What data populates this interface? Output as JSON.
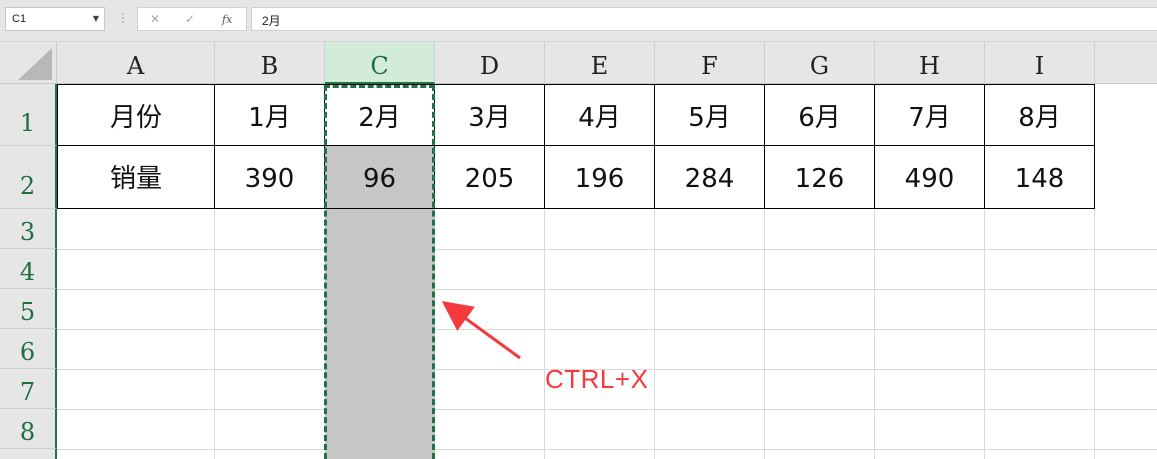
{
  "formula_bar": {
    "name_box": "C1",
    "cancel_glyph": "✕",
    "enter_glyph": "✓",
    "fx_label": "fx",
    "formula": "2月"
  },
  "columns": [
    "A",
    "B",
    "C",
    "D",
    "E",
    "F",
    "G",
    "H",
    "I"
  ],
  "selected_column": "C",
  "rows": [
    "1",
    "2",
    "3",
    "4",
    "5",
    "6",
    "7",
    "8"
  ],
  "table": {
    "row1": [
      "月份",
      "1月",
      "2月",
      "3月",
      "4月",
      "5月",
      "6月",
      "7月",
      "8月"
    ],
    "row2": [
      "销量",
      "390",
      "96",
      "205",
      "196",
      "284",
      "126",
      "490",
      "148"
    ]
  },
  "annotation": {
    "text": "CTRL+X",
    "color": "#f43a3a"
  },
  "colors": {
    "accent": "#217346",
    "selection": "#c6c6c6"
  }
}
